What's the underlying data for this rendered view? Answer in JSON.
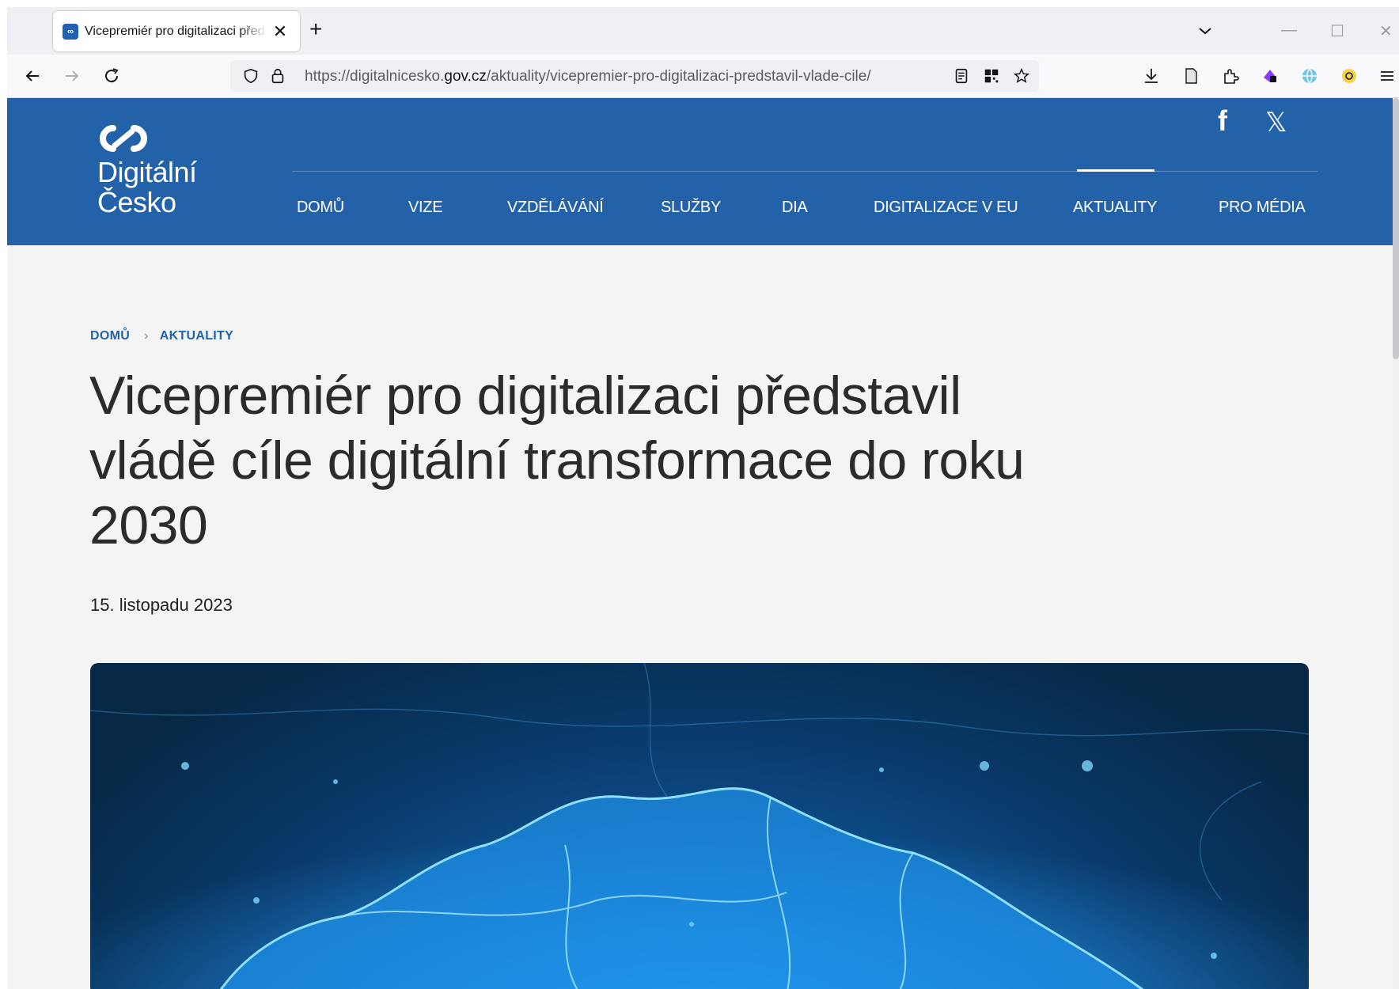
{
  "browser": {
    "tab": {
      "title": "Vicepremiér pro digitalizaci před",
      "favicon": "∞"
    },
    "url": {
      "prefix": "https://digitalnicesko.",
      "domain": "gov.cz",
      "path": "/aktuality/vicepremier-pro-digitalizaci-predstavil-vlade-cile/"
    }
  },
  "site": {
    "logo": {
      "line1": "Digitální",
      "line2": "Česko"
    },
    "nav": [
      {
        "label": "DOMŮ"
      },
      {
        "label": "VIZE"
      },
      {
        "label": "VZDĚLÁVÁNÍ"
      },
      {
        "label": "SLUŽBY"
      },
      {
        "label": "DIA"
      },
      {
        "label": "DIGITALIZACE V EU"
      },
      {
        "label": "AKTUALITY",
        "active": true
      },
      {
        "label": "PRO MÉDIA"
      }
    ],
    "social": {
      "facebook": "f",
      "x": "𝕏"
    }
  },
  "breadcrumb": [
    "DOMŮ",
    "AKTUALITY"
  ],
  "article": {
    "title": "Vicepremiér pro digitalizaci představil vládě cíle digitální transformace do roku 2030",
    "date": "15. listopadu 2023"
  },
  "colors": {
    "brand": "#2362a8",
    "background": "#f4f4f4"
  }
}
